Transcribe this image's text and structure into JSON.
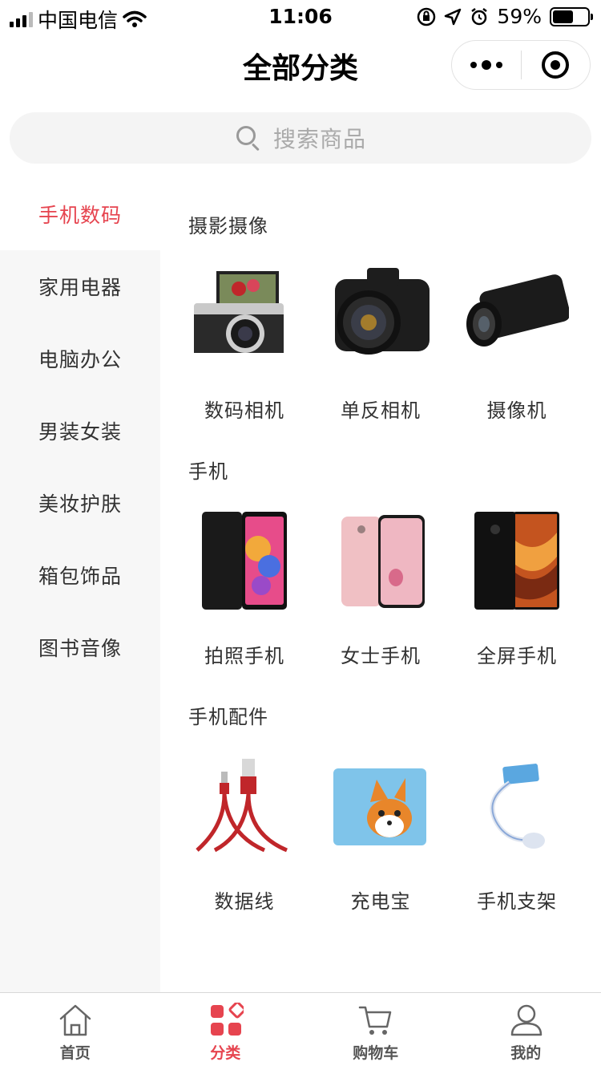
{
  "status_bar": {
    "carrier": "中国电信",
    "time": "11:06",
    "battery": "59%",
    "battery_level": 0.59
  },
  "nav": {
    "title": "全部分类"
  },
  "search": {
    "placeholder": "搜索商品"
  },
  "sidebar": {
    "items": [
      {
        "label": "手机数码",
        "active": true
      },
      {
        "label": "家用电器",
        "active": false
      },
      {
        "label": "电脑办公",
        "active": false
      },
      {
        "label": "男装女装",
        "active": false
      },
      {
        "label": "美妆护肤",
        "active": false
      },
      {
        "label": "箱包饰品",
        "active": false
      },
      {
        "label": "图书音像",
        "active": false
      }
    ]
  },
  "sections": [
    {
      "title": "摄影摄像",
      "items": [
        {
          "label": "数码相机",
          "image": "mirrorless-camera-image"
        },
        {
          "label": "单反相机",
          "image": "dslr-camera-image"
        },
        {
          "label": "摄像机",
          "image": "camcorder-image"
        }
      ]
    },
    {
      "title": "手机",
      "items": [
        {
          "label": "拍照手机",
          "image": "phone-black-image"
        },
        {
          "label": "女士手机",
          "image": "phone-pink-image"
        },
        {
          "label": "全屏手机",
          "image": "phone-fullscreen-image"
        }
      ]
    },
    {
      "title": "手机配件",
      "items": [
        {
          "label": "数据线",
          "image": "usb-cable-image"
        },
        {
          "label": "充电宝",
          "image": "power-bank-image"
        },
        {
          "label": "手机支架",
          "image": "phone-holder-image"
        }
      ]
    }
  ],
  "tab_bar": {
    "items": [
      {
        "label": "首页",
        "icon": "home-icon",
        "active": false
      },
      {
        "label": "分类",
        "icon": "category-icon",
        "active": true
      },
      {
        "label": "购物车",
        "icon": "cart-icon",
        "active": false
      },
      {
        "label": "我的",
        "icon": "user-icon",
        "active": false
      }
    ]
  },
  "colors": {
    "accent": "#e6444f",
    "sidebar_bg": "#f7f7f7",
    "search_bg": "#f4f4f4"
  }
}
